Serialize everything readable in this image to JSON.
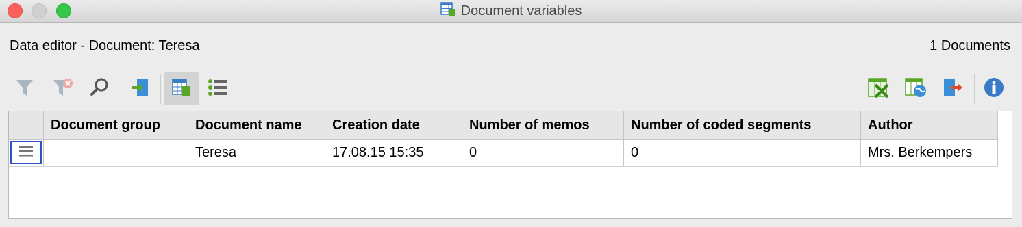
{
  "window": {
    "title": "Document variables",
    "title_icon": "data-table-icon"
  },
  "header": {
    "left": "Data editor - Document: Teresa",
    "right": "1 Documents"
  },
  "toolbar": {
    "left": [
      "filter-icon",
      "clear-filter-icon",
      "search-icon",
      "import-icon",
      "data-table-view-icon",
      "list-view-icon"
    ],
    "right": [
      "export-excel-icon",
      "export-html-icon",
      "export-icon",
      "info-icon"
    ],
    "active": "data-table-view-icon"
  },
  "table": {
    "columns": [
      "Document group",
      "Document name",
      "Creation date",
      "Number of memos",
      "Number of coded segments",
      "Author"
    ],
    "rows": [
      {
        "document_group": "",
        "document_name": "Teresa",
        "creation_date": "17.08.15 15:35",
        "memos": "0",
        "coded_segments": "0",
        "author": "Mrs. Berkempers"
      }
    ]
  },
  "colors": {
    "accent_blue": "#2f4ed0",
    "green": "#5aa628",
    "icon_blue": "#3a8fd6",
    "red_close": "#fc605c",
    "green_zoom": "#34c84a"
  }
}
